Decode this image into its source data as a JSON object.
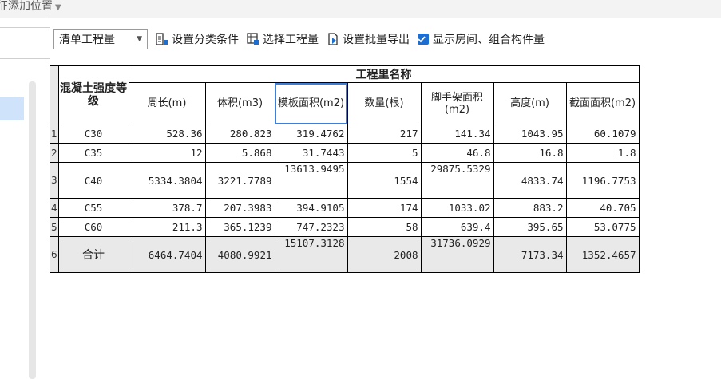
{
  "top_crumb": {
    "label": "征添加位置"
  },
  "toolbar": {
    "dropdown_value": "清单工程量",
    "set_category_label": "设置分类条件",
    "select_project_label": "选择工程量",
    "batch_export_label": "设置批量导出",
    "show_rooms_label": "显示房间、组合构件量",
    "show_rooms_checked": true
  },
  "table": {
    "group_header": "工程里名称",
    "first_header": "混凝土强度等级",
    "columns": [
      "周长(m)",
      "体积(m3)",
      "模板面积(m2)",
      "数量(根)",
      "脚手架面积(m2)",
      "高度(m)",
      "截面面积(m2)"
    ],
    "rows": [
      {
        "n": "1",
        "grade": "C30",
        "values": [
          "528.36",
          "280.823",
          "319.4762",
          "217",
          "141.34",
          "1043.95",
          "60.1079"
        ]
      },
      {
        "n": "2",
        "grade": "C35",
        "values": [
          "12",
          "5.868",
          "31.7443",
          "5",
          "46.8",
          "16.8",
          "1.8"
        ]
      },
      {
        "n": "3",
        "grade": "C40",
        "values": [
          "5334.3804",
          "3221.7789",
          "13613.9495",
          "1554",
          "29875.5329",
          "4833.74",
          "1196.7753"
        ]
      },
      {
        "n": "4",
        "grade": "C55",
        "values": [
          "378.7",
          "207.3983",
          "394.9105",
          "174",
          "1033.02",
          "883.2",
          "40.705"
        ]
      },
      {
        "n": "5",
        "grade": "C60",
        "values": [
          "211.3",
          "365.1239",
          "747.2323",
          "58",
          "639.4",
          "395.65",
          "53.0775"
        ]
      },
      {
        "n": "6",
        "grade": "合计",
        "values": [
          "6464.7404",
          "4080.9921",
          "15107.3128",
          "2008",
          "31736.0929",
          "7173.34",
          "1352.4657"
        ]
      }
    ]
  }
}
